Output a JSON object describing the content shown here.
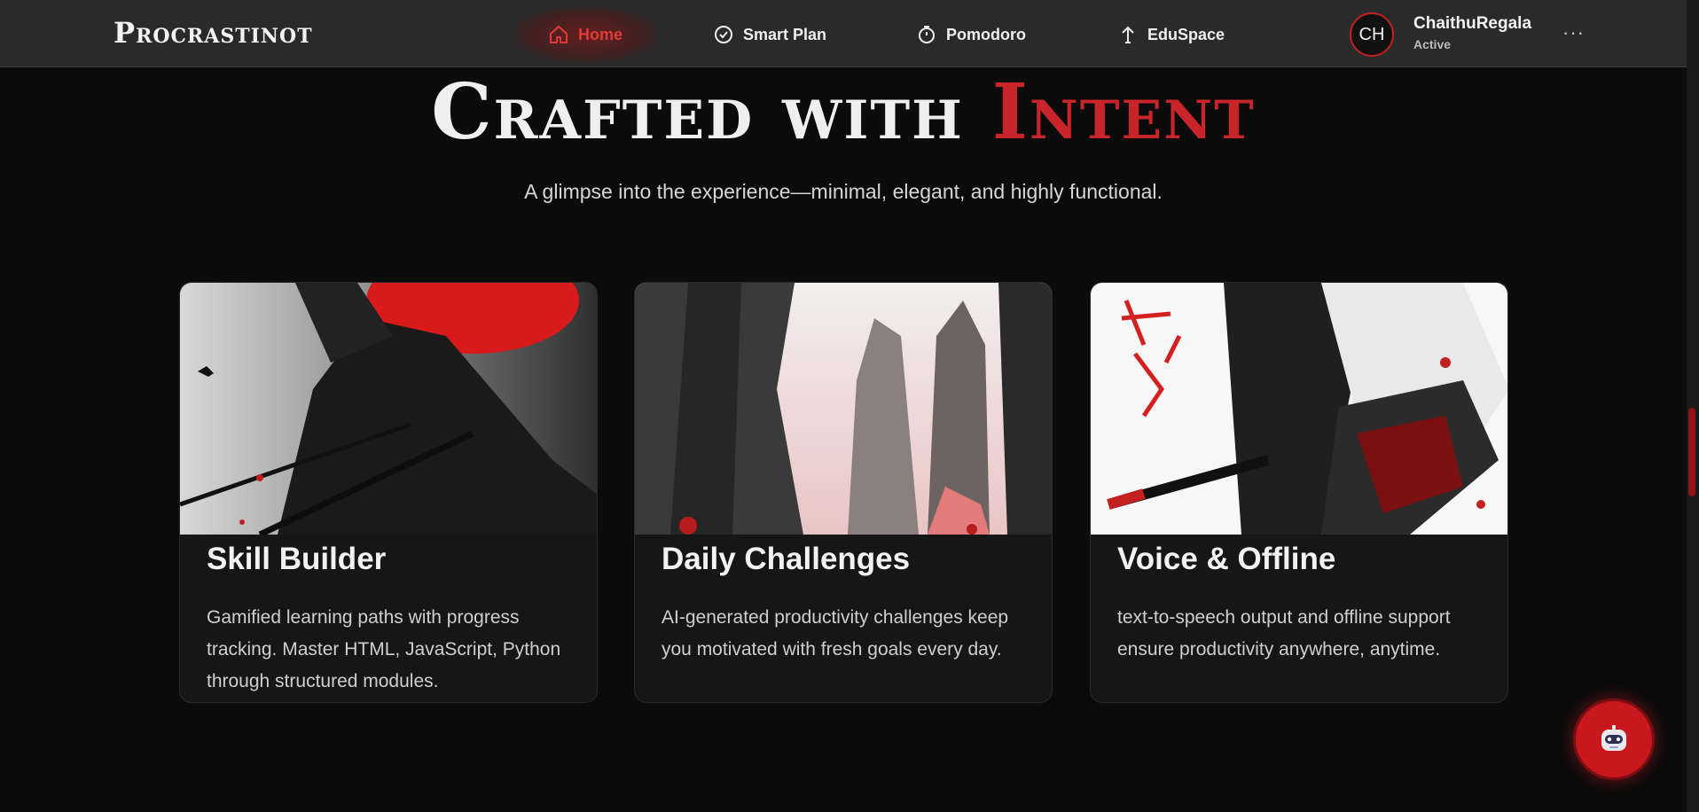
{
  "nav": {
    "logo": "Procrastinot",
    "items": [
      {
        "label": "Home",
        "icon": "home-icon",
        "active": true
      },
      {
        "label": "Smart Plan",
        "icon": "check-circle-icon"
      },
      {
        "label": "Pomodoro",
        "icon": "timer-icon"
      },
      {
        "label": "EduSpace",
        "icon": "upload-arrow-icon"
      }
    ],
    "user": {
      "initials": "CH",
      "name": "ChaithuRegala",
      "status": "Active"
    },
    "more_label": "···"
  },
  "hero": {
    "title_part1": "Crafted with",
    "title_part2": "Intent",
    "subtitle": "A glimpse into the experience—minimal, elegant, and highly functional."
  },
  "cards": [
    {
      "title": "Skill Builder",
      "description": "Gamified learning paths with progress tracking. Master HTML, JavaScript, Python through structured modules.",
      "image": "samurai-red-sun-image"
    },
    {
      "title": "Daily Challenges",
      "description": "AI-generated productivity challenges keep you motivated with fresh goals every day.",
      "image": "ink-mountains-image"
    },
    {
      "title": "Voice & Offline",
      "description": "text-to-speech output and offline support ensure productivity anywhere, anytime.",
      "image": "warrior-red-calligraphy-image"
    }
  ],
  "chat_bot": {
    "icon": "robot-icon"
  },
  "colors": {
    "accent": "#c9242a",
    "background": "#0b0b0b",
    "navbar": "#2a2a2a",
    "card": "#161616"
  }
}
